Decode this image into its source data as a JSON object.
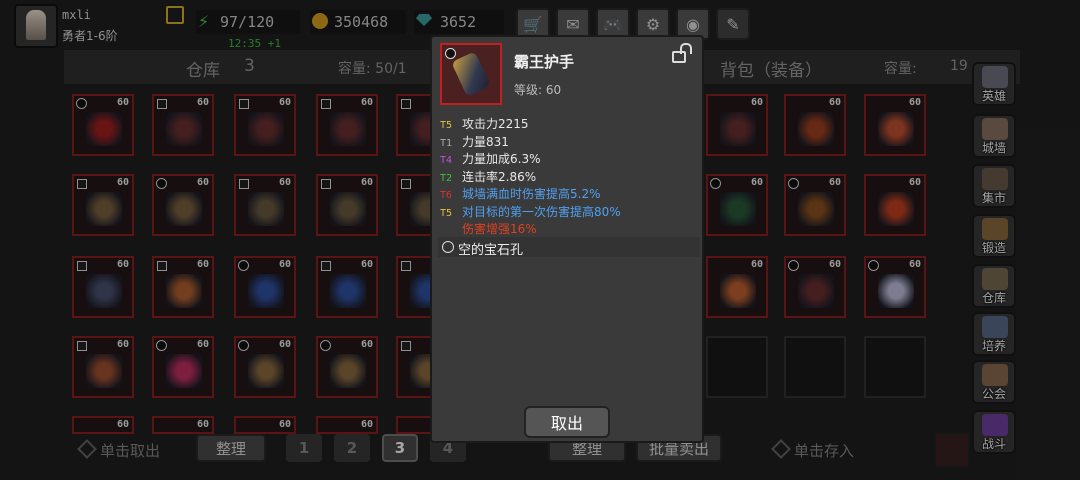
{
  "player": {
    "name": "mxli",
    "rank": "勇者1-6阶"
  },
  "resources": {
    "stamina": "97/120",
    "stamina_regen": "12:35 +1",
    "gold": "350468",
    "gems": "3652"
  },
  "warehouse": {
    "title": "仓库",
    "count": "3",
    "capacity_label": "容量: 50/1"
  },
  "backpack": {
    "title": "背包（装备）",
    "capacity_label": "容量:",
    "capacity_value": "19"
  },
  "slot_level": "60",
  "bottom": {
    "click_take": "单击取出",
    "sort": "整理",
    "pages": [
      "1",
      "2",
      "3",
      "4"
    ],
    "active_page": "3",
    "sort2": "整理",
    "batch_sell": "批量卖出",
    "click_store": "单击存入"
  },
  "sidebar": [
    "英雄",
    "城墙",
    "集市",
    "锻造",
    "仓库",
    "培养",
    "公会",
    "战斗"
  ],
  "item": {
    "name": "霸王护手",
    "level": "等级: 60",
    "stats": [
      {
        "tier": "T5",
        "text": "攻击力2215",
        "tier_color": "#e0c040",
        "text_color": "#e8e8e8"
      },
      {
        "tier": "T1",
        "text": "力量831",
        "tier_color": "#aaaaaa",
        "text_color": "#e8e8e8"
      },
      {
        "tier": "T4",
        "text": "力量加成6.3%",
        "tier_color": "#c050e0",
        "text_color": "#e8e8e8"
      },
      {
        "tier": "T2",
        "text": "连击率2.86%",
        "tier_color": "#40c040",
        "text_color": "#e8e8e8"
      },
      {
        "tier": "T6",
        "text": "城墙满血时伤害提高5.2%",
        "tier_color": "#e03030",
        "text_color": "#50a0f0"
      },
      {
        "tier": "T5",
        "text": "对目标的第一次伤害提高80%",
        "tier_color": "#e0c040",
        "text_color": "#50a0f0"
      },
      {
        "tier": "",
        "text": "伤害增强16%",
        "tier_color": "#e03030",
        "text_color": "#e04020"
      }
    ],
    "gem_socket": "空的宝石孔",
    "cancel": "取出"
  },
  "colors": {
    "slot_border": "#8a2020",
    "accent_gold": "#d8b030",
    "regen_green": "#3ec03e"
  }
}
